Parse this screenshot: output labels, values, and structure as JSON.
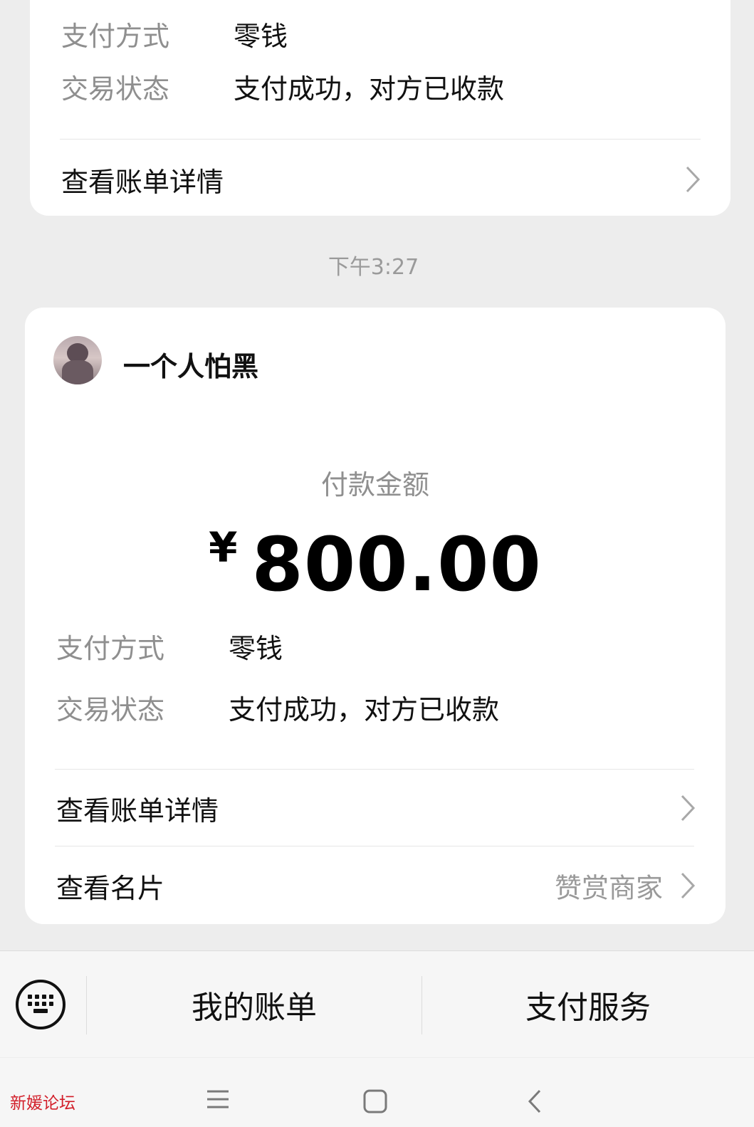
{
  "card_top": {
    "payment_method_label": "支付方式",
    "payment_method_value": "零钱",
    "status_label": "交易状态",
    "status_value": "支付成功，对方已收款",
    "view_bill_label": "查看账单详情"
  },
  "timestamp": "下午3:27",
  "card_main": {
    "username": "一个人怕黑",
    "amount_label": "付款金额",
    "currency_symbol": "¥",
    "amount": "800.00",
    "payment_method_label": "支付方式",
    "payment_method_value": "零钱",
    "status_label": "交易状态",
    "status_value": "支付成功，对方已收款",
    "view_bill_label": "查看账单详情",
    "view_card_label": "查看名片",
    "reward_merchant_label": "赞赏商家"
  },
  "bottom_bar": {
    "my_bills_label": "我的账单",
    "pay_service_label": "支付服务"
  },
  "watermark": "新媛论坛",
  "icons": {
    "keyboard": "keyboard-icon",
    "chevron": "chevron-right-icon",
    "menu": "menu-icon",
    "home": "home-icon",
    "back": "back-icon"
  }
}
